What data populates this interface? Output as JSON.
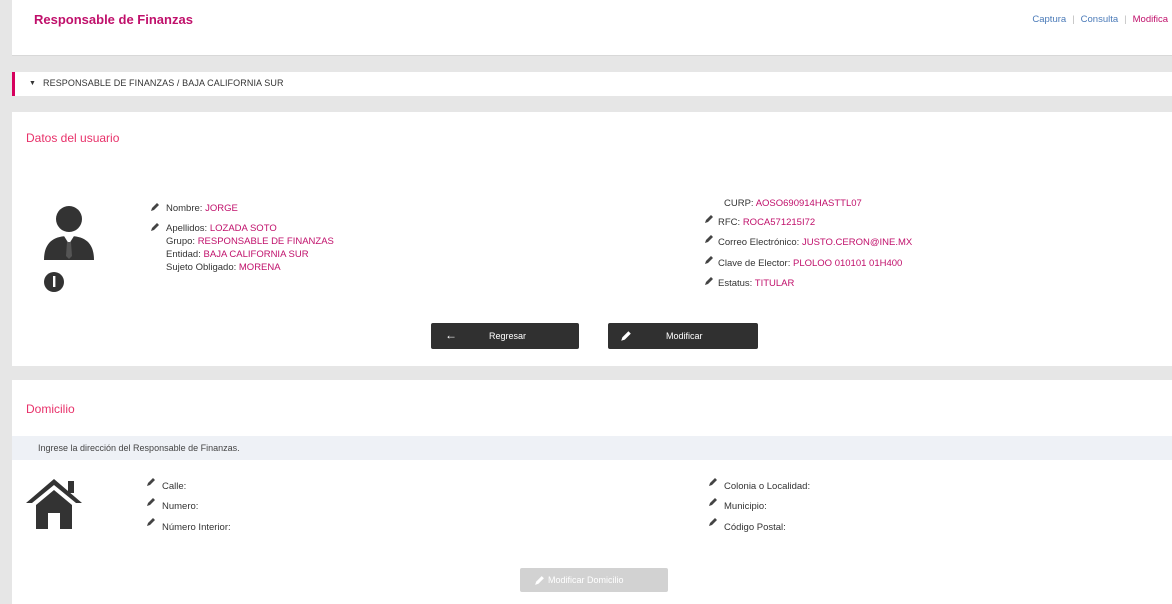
{
  "header": {
    "title": "Responsable de Finanzas",
    "nav": [
      "Captura",
      "Consulta",
      "Modifica"
    ]
  },
  "breadcrumb": "RESPONSABLE DE FINANZAS / BAJA CALIFORNIA SUR",
  "user_section": {
    "title": "Datos del usuario",
    "left_fields": [
      {
        "label": "Nombre:",
        "value": "JORGE"
      },
      {
        "label": "Apellidos:",
        "value": "LOZADA SOTO"
      },
      {
        "label": "Grupo:",
        "value": "RESPONSABLE DE FINANZAS"
      },
      {
        "label": "Entidad:",
        "value": "BAJA CALIFORNIA SUR"
      },
      {
        "label": "Sujeto Obligado:",
        "value": "MORENA"
      }
    ],
    "right_fields": [
      {
        "label": "CURP:",
        "value": "AOSO690914HASTTL07"
      },
      {
        "label": "RFC:",
        "value": "ROCA571215I72"
      },
      {
        "label": "Correo Electrónico:",
        "value": "JUSTO.CERON@INE.MX"
      },
      {
        "label": "Clave de Elector:",
        "value": "PLOLOO 010101 01H400"
      },
      {
        "label": "Estatus:",
        "value": "TITULAR"
      }
    ],
    "back_button": "Regresar",
    "edit_button": "Modificar"
  },
  "address_section": {
    "title": "Domicilio",
    "instruction": "Ingrese la dirección del Responsable de Finanzas.",
    "left_fields": [
      "Calle:",
      "Numero:",
      "Número Interior:"
    ],
    "right_fields": [
      "Colonia o Localidad:",
      "Municipio:",
      "Código Postal:"
    ],
    "edit_address_button": "Modificar Domicilio"
  },
  "colors": {
    "accent": "#c0106b",
    "link": "#4a7ab8",
    "button": "#303030"
  }
}
